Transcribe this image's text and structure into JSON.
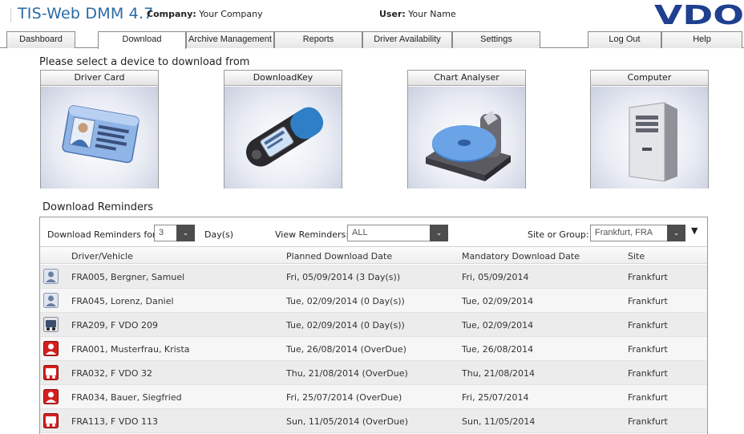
{
  "header": {
    "app_title": "TIS-Web DMM 4.7",
    "company_label": "Company:",
    "company_value": "Your Company",
    "user_label": "User:",
    "user_value": "Your Name",
    "logo_text": "VDO"
  },
  "tabs": [
    {
      "label": "Dashboard",
      "active": false
    },
    {
      "label": "Download",
      "active": true
    },
    {
      "label": "Archive Management",
      "active": false
    },
    {
      "label": "Reports",
      "active": false
    },
    {
      "label": "Driver Availability",
      "active": false
    },
    {
      "label": "Settings",
      "active": false
    },
    {
      "label": "Log Out",
      "active": false
    },
    {
      "label": "Help",
      "active": false
    }
  ],
  "devices": {
    "heading": "Please select a device to download from",
    "items": [
      {
        "label": "Driver Card",
        "icon": "driver-card-icon"
      },
      {
        "label": "DownloadKey",
        "icon": "download-key-icon"
      },
      {
        "label": "Chart Analyser",
        "icon": "chart-analyser-icon"
      },
      {
        "label": "Computer",
        "icon": "computer-icon"
      }
    ]
  },
  "reminders": {
    "heading": "Download Reminders",
    "filter": {
      "days_label": "Download Reminders for:",
      "days_value": "3",
      "days_unit": "Day(s)",
      "view_label": "View Reminders:",
      "view_value": "ALL",
      "site_label": "Site or Group:",
      "site_value": "Frankfurt, FRA",
      "dropdown_glyph": "⌄",
      "menu_glyph": "▼"
    },
    "columns": [
      "Driver/Vehicle",
      "Planned Download Date",
      "Mandatory Download Date",
      "Site"
    ],
    "rows": [
      {
        "type": "driver",
        "status": "ok",
        "name": "FRA005, Bergner, Samuel",
        "planned": "Fri, 05/09/2014 (3 Day(s))",
        "mandatory": "Fri, 05/09/2014",
        "site": "Frankfurt"
      },
      {
        "type": "driver",
        "status": "ok",
        "name": "FRA045, Lorenz, Daniel",
        "planned": "Tue, 02/09/2014 (0 Day(s))",
        "mandatory": "Tue, 02/09/2014",
        "site": "Frankfurt"
      },
      {
        "type": "vehicle",
        "status": "ok",
        "name": "FRA209, F VDO 209",
        "planned": "Tue, 02/09/2014 (0 Day(s))",
        "mandatory": "Tue, 02/09/2014",
        "site": "Frankfurt"
      },
      {
        "type": "driver",
        "status": "overdue",
        "name": "FRA001, Musterfrau, Krista",
        "planned": "Tue, 26/08/2014 (OverDue)",
        "mandatory": "Tue, 26/08/2014",
        "site": "Frankfurt"
      },
      {
        "type": "vehicle",
        "status": "overdue",
        "name": "FRA032, F VDO 32",
        "planned": "Thu, 21/08/2014 (OverDue)",
        "mandatory": "Thu, 21/08/2014",
        "site": "Frankfurt"
      },
      {
        "type": "driver",
        "status": "overdue",
        "name": "FRA034, Bauer, Siegfried",
        "planned": "Fri, 25/07/2014 (OverDue)",
        "mandatory": "Fri, 25/07/2014",
        "site": "Frankfurt"
      },
      {
        "type": "vehicle",
        "status": "overdue",
        "name": "FRA113, F VDO 113",
        "planned": "Sun, 11/05/2014 (OverDue)",
        "mandatory": "Sun, 11/05/2014",
        "site": "Frankfurt"
      }
    ]
  },
  "colors": {
    "title_blue": "#2a6aa6",
    "logo_blue": "#1f3f8f",
    "overdue_red": "#d42020",
    "select_button": "#4d4d4d"
  }
}
